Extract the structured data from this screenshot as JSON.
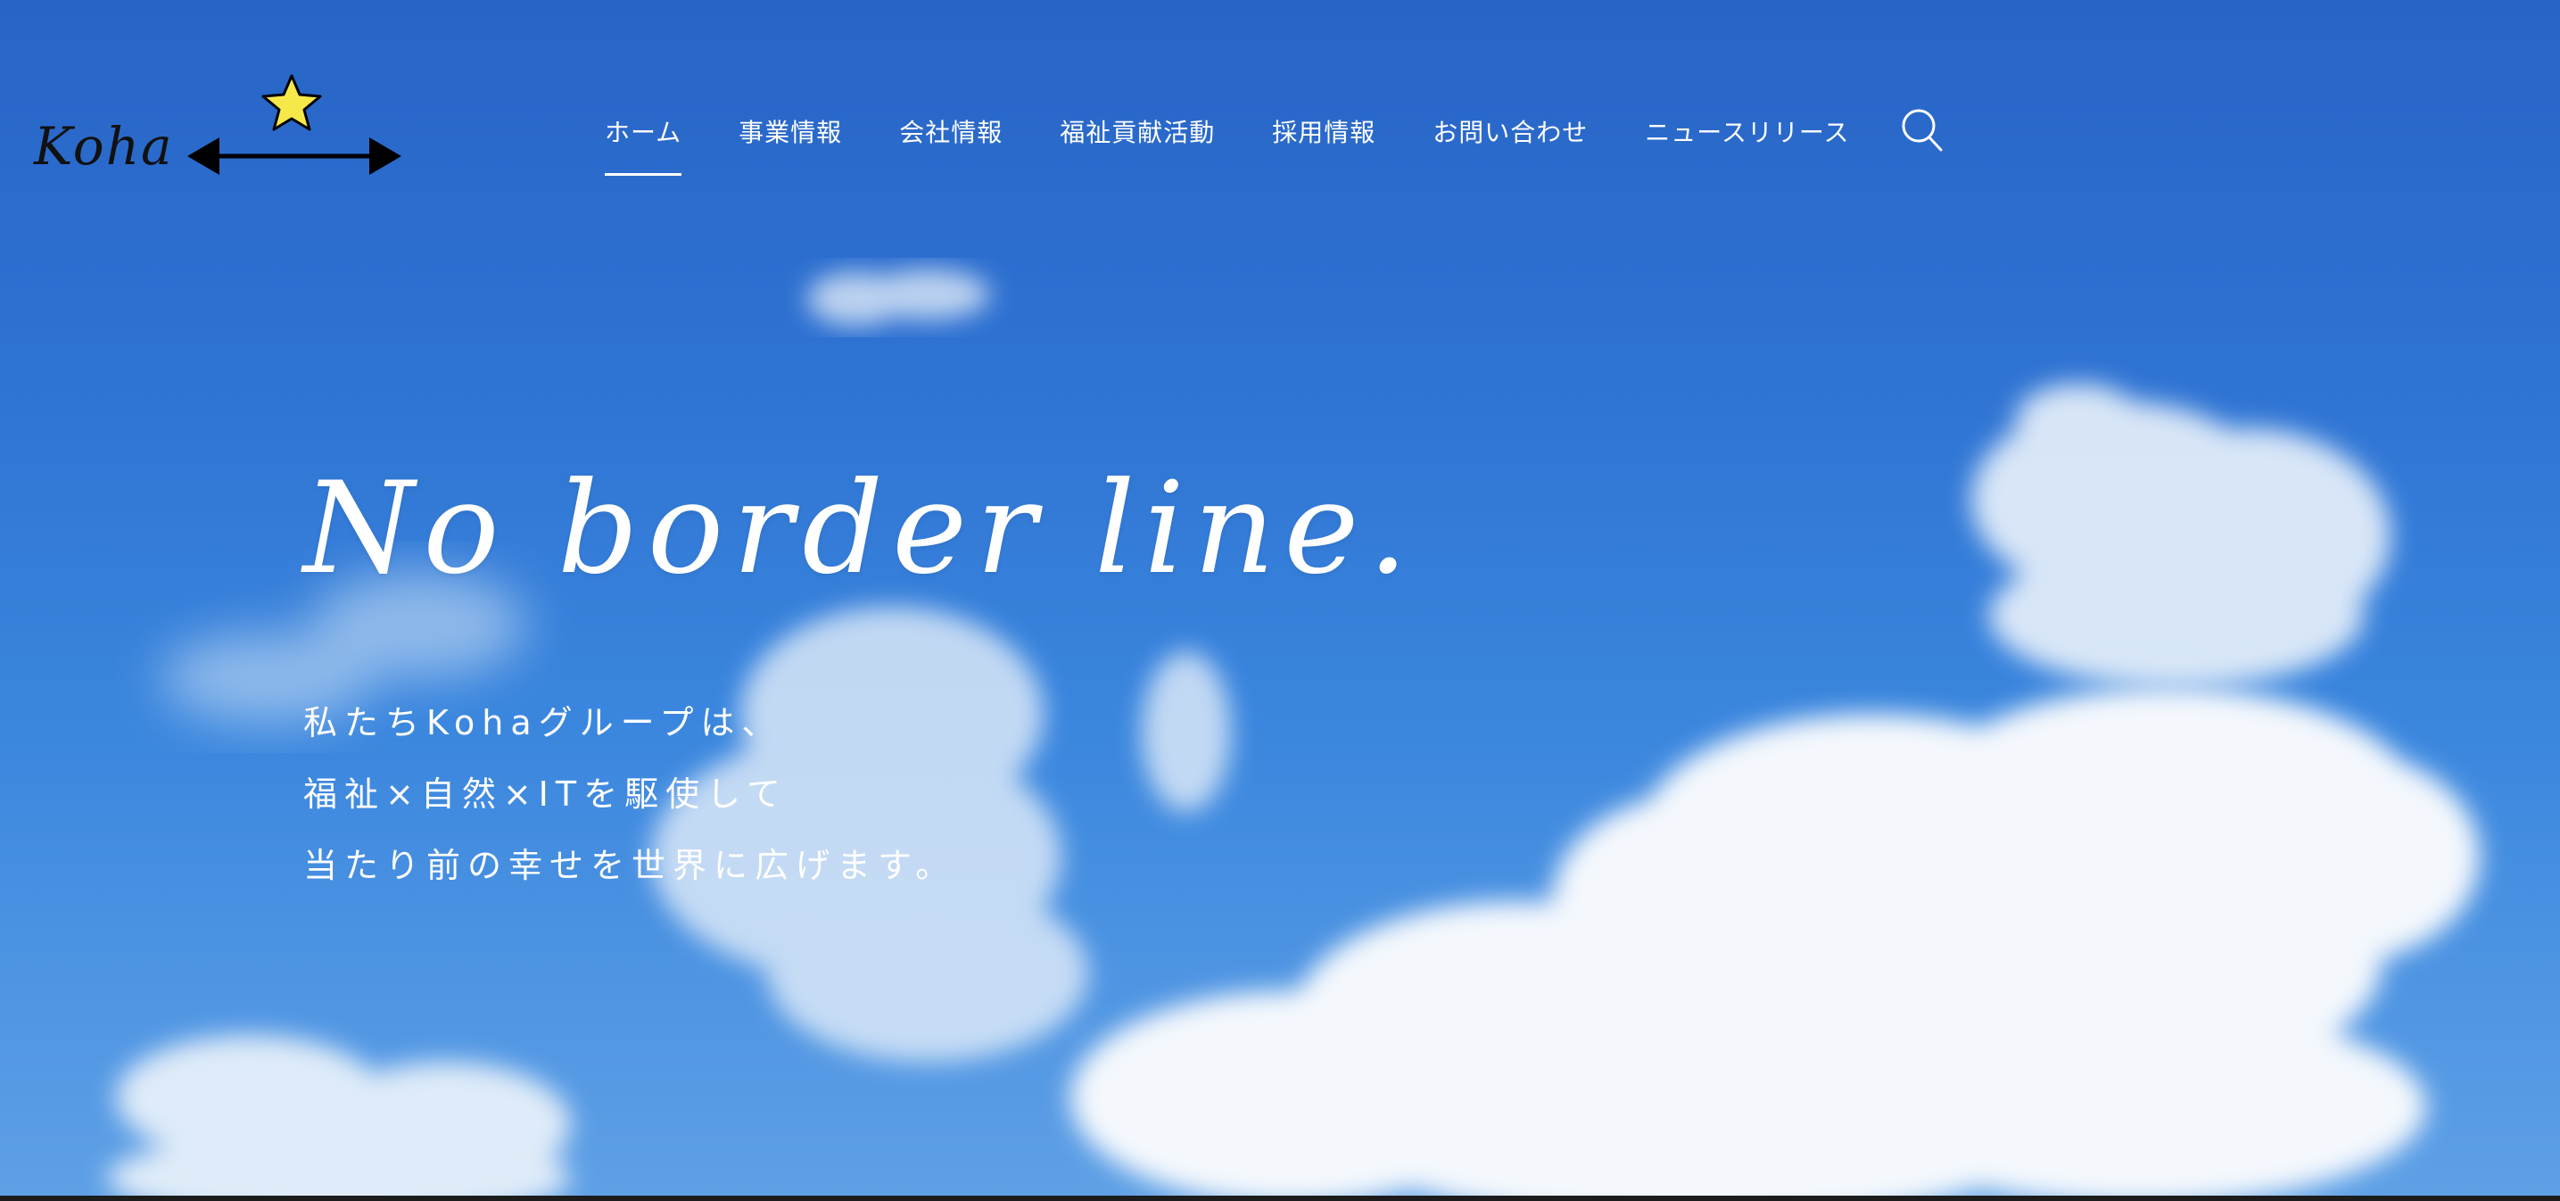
{
  "brand": {
    "logo_text": "Koha",
    "star_color": "#f7e84a"
  },
  "nav": {
    "items": [
      {
        "label": "ホーム",
        "active": true
      },
      {
        "label": "事業情報"
      },
      {
        "label": "会社情報"
      },
      {
        "label": "福祉貢献活動"
      },
      {
        "label": "採用情報"
      },
      {
        "label": "お問い合わせ"
      },
      {
        "label": "ニュースリリース"
      }
    ],
    "search_icon": "search-icon"
  },
  "hero": {
    "headline": "No border line.",
    "tagline": [
      "私たちKohaグループは、",
      "福祉×自然×ITを駆使して",
      "当たり前の幸せを世界に広げます。"
    ]
  },
  "colors": {
    "sky_top": "#2764c6",
    "sky_bottom": "#5ea0e6",
    "text": "#ffffff"
  }
}
